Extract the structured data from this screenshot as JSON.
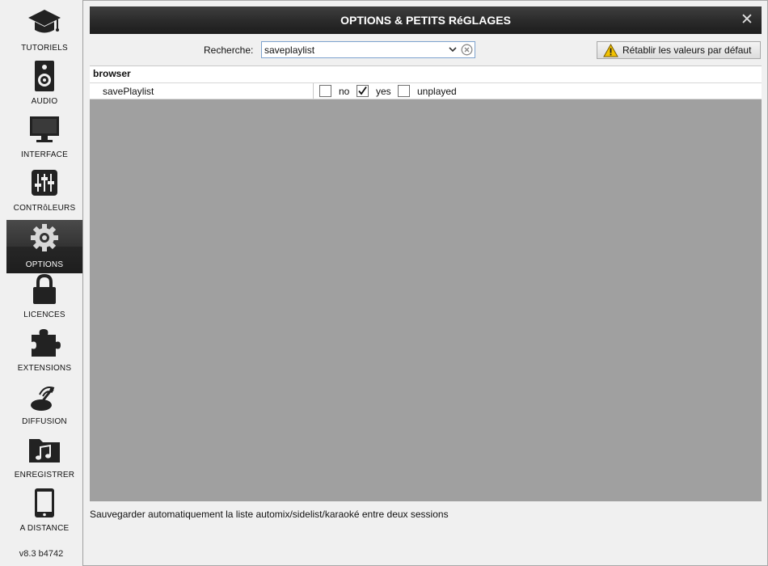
{
  "sidebar": {
    "items": [
      {
        "label": "TUTORIELS",
        "icon": "graduation-cap-icon"
      },
      {
        "label": "AUDIO",
        "icon": "speaker-icon"
      },
      {
        "label": "INTERFACE",
        "icon": "monitor-icon"
      },
      {
        "label": "CONTRôLEURS",
        "icon": "sliders-icon"
      },
      {
        "label": "OPTIONS",
        "icon": "gear-icon",
        "active": true
      },
      {
        "label": "LICENCES",
        "icon": "lock-icon"
      },
      {
        "label": "EXTENSIONS",
        "icon": "puzzle-icon"
      },
      {
        "label": "DIFFUSION",
        "icon": "broadcast-icon"
      },
      {
        "label": "ENREGISTRER",
        "icon": "music-folder-icon"
      },
      {
        "label": "A DISTANCE",
        "icon": "tablet-icon"
      }
    ],
    "version": "v8.3 b4742"
  },
  "window": {
    "title": "OPTIONS & PETITS RéGLAGES",
    "close_glyph": "✕"
  },
  "search": {
    "label": "Recherche:",
    "value": "saveplaylist"
  },
  "reset_button": {
    "label": "Rétablir les valeurs par défaut"
  },
  "options": {
    "group": "browser",
    "rows": [
      {
        "name": "savePlaylist",
        "choices": [
          {
            "label": "no",
            "checked": false
          },
          {
            "label": "yes",
            "checked": true
          },
          {
            "label": "unplayed",
            "checked": false
          }
        ]
      }
    ]
  },
  "description": "Sauvegarder automatiquement la liste automix/sidelist/karaoké entre deux sessions",
  "colors": {
    "titlebar": "#2a2a2a",
    "panel_bg": "#a0a0a0",
    "active_nav": "#2b2b2b",
    "warning": "#f2c200"
  }
}
